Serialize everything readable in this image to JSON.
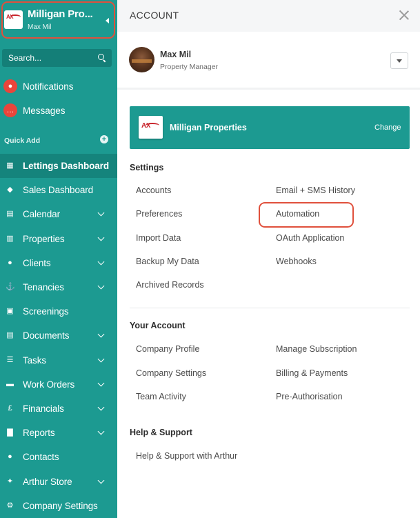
{
  "sidebar": {
    "org_name": "Milligan Pro...",
    "org_user": "Max Mil",
    "search_placeholder": "Search...",
    "notifications_label": "Notifications",
    "messages_label": "Messages",
    "quick_add_label": "Quick Add",
    "nav_items": [
      {
        "label": "Lettings Dashboard",
        "icon": "dashboard-icon",
        "active": true,
        "expandable": false
      },
      {
        "label": "Sales Dashboard",
        "icon": "tag-icon",
        "active": false,
        "expandable": false
      },
      {
        "label": "Calendar",
        "icon": "calendar-icon",
        "active": false,
        "expandable": true
      },
      {
        "label": "Properties",
        "icon": "building-icon",
        "active": false,
        "expandable": true
      },
      {
        "label": "Clients",
        "icon": "person-icon",
        "active": false,
        "expandable": true
      },
      {
        "label": "Tenancies",
        "icon": "tenant-icon",
        "active": false,
        "expandable": true
      },
      {
        "label": "Screenings",
        "icon": "id-card-icon",
        "active": false,
        "expandable": false
      },
      {
        "label": "Documents",
        "icon": "document-icon",
        "active": false,
        "expandable": true
      },
      {
        "label": "Tasks",
        "icon": "tasks-icon",
        "active": false,
        "expandable": true
      },
      {
        "label": "Work Orders",
        "icon": "briefcase-icon",
        "active": false,
        "expandable": true
      },
      {
        "label": "Financials",
        "icon": "pound-icon",
        "active": false,
        "expandable": true
      },
      {
        "label": "Reports",
        "icon": "bar-chart-icon",
        "active": false,
        "expandable": true
      },
      {
        "label": "Contacts",
        "icon": "people-icon",
        "active": false,
        "expandable": false
      },
      {
        "label": "Arthur Store",
        "icon": "puzzle-icon",
        "active": false,
        "expandable": true
      },
      {
        "label": "Company Settings",
        "icon": "gear-icon",
        "active": false,
        "expandable": false
      }
    ]
  },
  "panel": {
    "title": "ACCOUNT",
    "profile": {
      "name": "Max Mil",
      "role": "Property Manager"
    },
    "company": {
      "name": "Milligan Properties",
      "change_label": "Change"
    },
    "settings": {
      "title": "Settings",
      "left": [
        "Accounts",
        "Preferences",
        "Import Data",
        "Backup My Data",
        "Archived Records"
      ],
      "right": [
        "Email + SMS History",
        "Automation",
        "OAuth Application",
        "Webhooks"
      ]
    },
    "your_account": {
      "title": "Your Account",
      "left": [
        "Company Profile",
        "Company Settings",
        "Team Activity"
      ],
      "right": [
        "Manage Subscription",
        "Billing & Payments",
        "Pre-Authorisation"
      ]
    },
    "help": {
      "title": "Help & Support",
      "left": [
        "Help & Support with Arthur"
      ]
    }
  },
  "colors": {
    "brand_teal": "#1c9a91",
    "highlight": "#e0503c",
    "notification_red": "#e9453b"
  }
}
